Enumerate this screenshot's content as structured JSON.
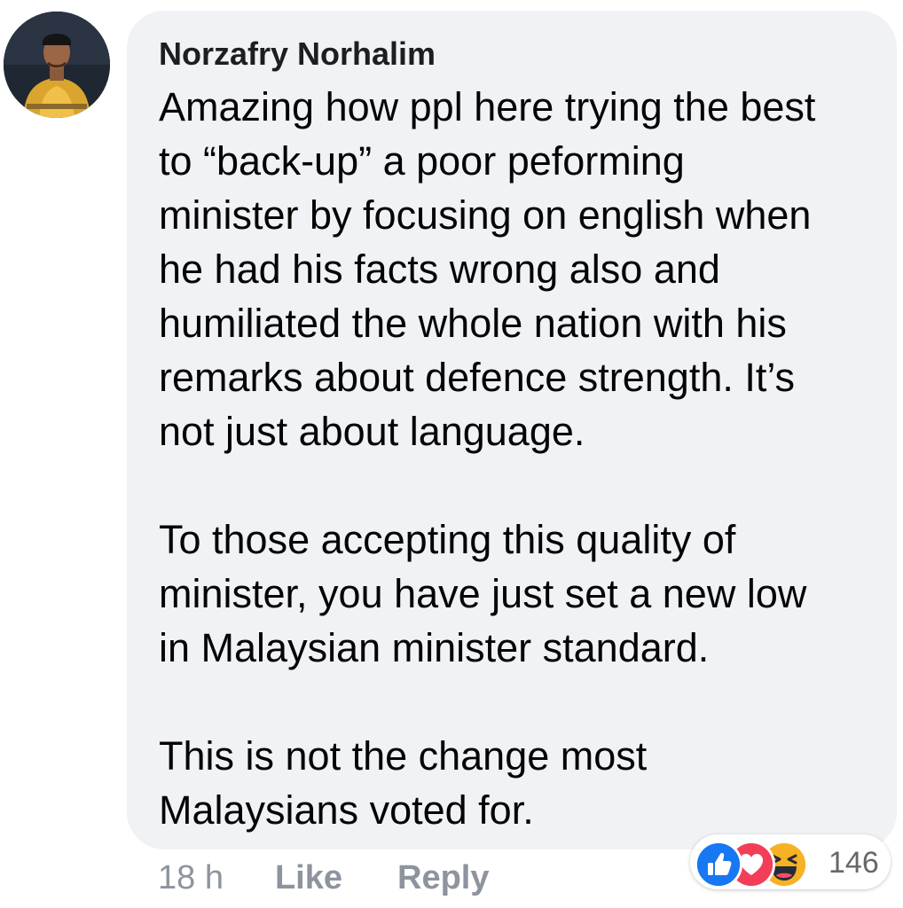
{
  "comment": {
    "author": "Norzafry Norhalim",
    "paragraphs": [
      "Amazing how ppl here trying the best\nto “back-up” a poor peforming\nminister by focusing on english when\nhe had his facts wrong also and\nhumiliated the whole nation with his\nremarks about defence strength. It’s\nnot just about language.",
      "To those accepting this quality of\nminister, you have just set a new low\nin Malaysian minister standard.",
      "This is not the change most\nMalaysians voted for."
    ],
    "time": "18 h",
    "like_label": "Like",
    "reply_label": "Reply",
    "reaction_count": "146",
    "reactions": [
      "like-icon",
      "love-icon",
      "haha-icon"
    ]
  },
  "colors": {
    "bubble": "#f0f2f5",
    "like": "#1877f2",
    "love": "#f33e58",
    "haha": "#f7b125",
    "meta_text": "#8d949e"
  }
}
